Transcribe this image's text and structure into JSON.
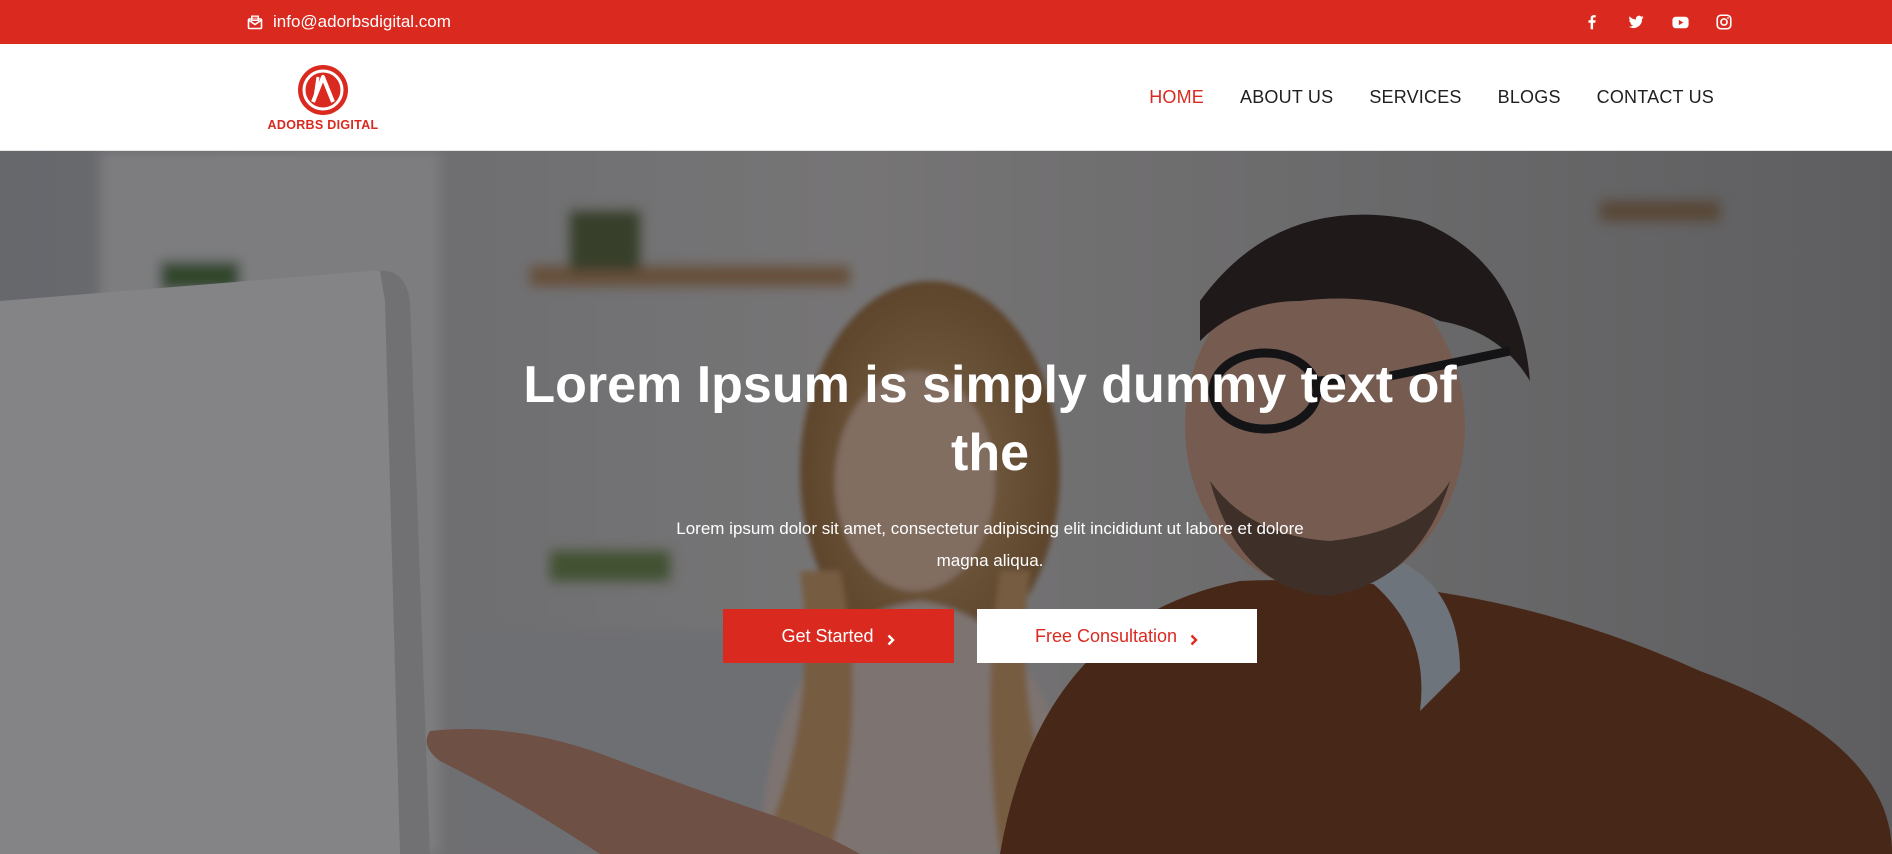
{
  "topbar": {
    "email": "info@adorbsdigital.com",
    "email_icon": "envelope-open-icon",
    "social": [
      "facebook-icon",
      "twitter-icon",
      "youtube-icon",
      "instagram-icon"
    ]
  },
  "logo": {
    "brand": "ADORBS DIGITAL"
  },
  "nav": {
    "items": [
      {
        "label": "HOME",
        "active": true
      },
      {
        "label": "ABOUT US",
        "active": false
      },
      {
        "label": "SERVICES",
        "active": false
      },
      {
        "label": "BLOGS",
        "active": false
      },
      {
        "label": "CONTACT US",
        "active": false
      }
    ]
  },
  "hero": {
    "title": "Lorem Ipsum is simply dummy text of the",
    "subtitle": "Lorem ipsum dolor sit amet, consectetur adipiscing elit incididunt ut labore et dolore magna aliqua.",
    "primary_button": "Get Started",
    "secondary_button": "Free Consultation",
    "background_description_icon": "office-photo"
  },
  "colors": {
    "accent": "#da2a20",
    "white": "#ffffff",
    "nav_text": "#1f1f1f"
  }
}
